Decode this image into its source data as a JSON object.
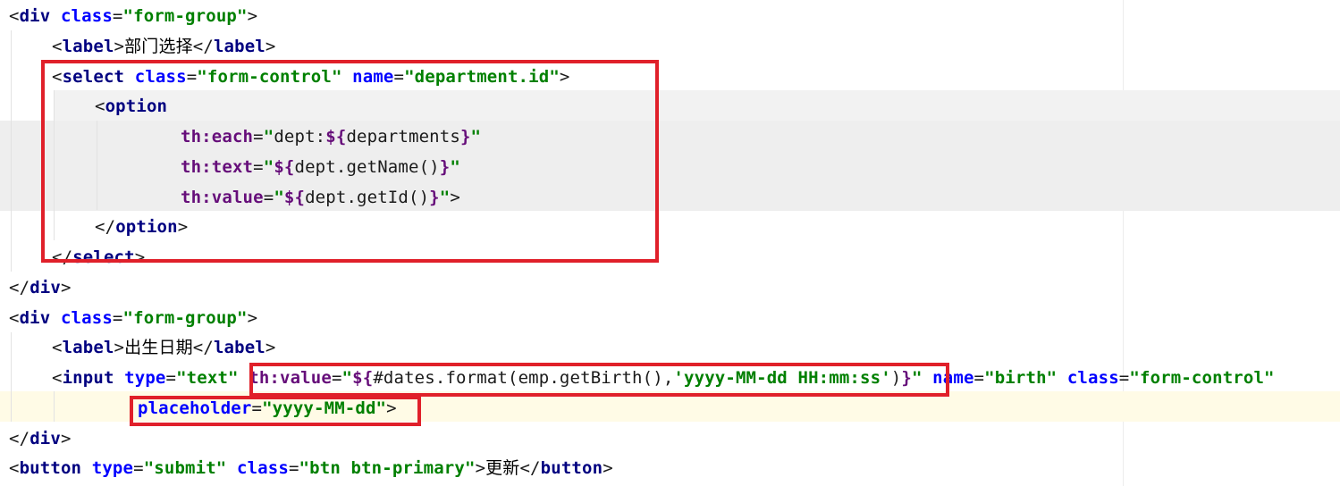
{
  "editor": {
    "lines": [
      {
        "indent": 0,
        "tokens": [
          {
            "t": "punct",
            "v": "<"
          },
          {
            "t": "tag",
            "v": "div"
          },
          {
            "t": "punct",
            "v": " "
          },
          {
            "t": "attr",
            "v": "class"
          },
          {
            "t": "punct",
            "v": "="
          },
          {
            "t": "val",
            "v": "\"form-group\""
          },
          {
            "t": "punct",
            "v": ">"
          }
        ]
      },
      {
        "indent": 1,
        "tokens": [
          {
            "t": "punct",
            "v": "<"
          },
          {
            "t": "tag",
            "v": "label"
          },
          {
            "t": "punct",
            "v": ">"
          },
          {
            "t": "text",
            "v": "部门选择"
          },
          {
            "t": "punct",
            "v": "</"
          },
          {
            "t": "tag",
            "v": "label"
          },
          {
            "t": "punct",
            "v": ">"
          }
        ]
      },
      {
        "indent": 1,
        "tokens": [
          {
            "t": "punct",
            "v": "<"
          },
          {
            "t": "tag",
            "v": "select"
          },
          {
            "t": "punct",
            "v": " "
          },
          {
            "t": "attr",
            "v": "class"
          },
          {
            "t": "punct",
            "v": "="
          },
          {
            "t": "val",
            "v": "\"form-control\""
          },
          {
            "t": "punct",
            "v": " "
          },
          {
            "t": "attr",
            "v": "name"
          },
          {
            "t": "punct",
            "v": "="
          },
          {
            "t": "val",
            "v": "\"department.id\""
          },
          {
            "t": "punct",
            "v": ">"
          }
        ]
      },
      {
        "indent": 2,
        "tokens": [
          {
            "t": "punct",
            "v": "<"
          },
          {
            "t": "tag",
            "v": "option"
          }
        ]
      },
      {
        "indent": 4,
        "tokens": [
          {
            "t": "th",
            "v": "th:each"
          },
          {
            "t": "punct",
            "v": "="
          },
          {
            "t": "val",
            "v": "\""
          },
          {
            "t": "expr",
            "v": "dept:"
          },
          {
            "t": "th",
            "v": "${"
          },
          {
            "t": "expr",
            "v": "departments"
          },
          {
            "t": "th",
            "v": "}"
          },
          {
            "t": "val",
            "v": "\""
          }
        ]
      },
      {
        "indent": 4,
        "tokens": [
          {
            "t": "th",
            "v": "th:text"
          },
          {
            "t": "punct",
            "v": "="
          },
          {
            "t": "val",
            "v": "\""
          },
          {
            "t": "th",
            "v": "${"
          },
          {
            "t": "expr",
            "v": "dept.getName()"
          },
          {
            "t": "th",
            "v": "}"
          },
          {
            "t": "val",
            "v": "\""
          }
        ]
      },
      {
        "indent": 4,
        "tokens": [
          {
            "t": "th",
            "v": "th:value"
          },
          {
            "t": "punct",
            "v": "="
          },
          {
            "t": "val",
            "v": "\""
          },
          {
            "t": "th",
            "v": "${"
          },
          {
            "t": "expr",
            "v": "dept.getId()"
          },
          {
            "t": "th",
            "v": "}"
          },
          {
            "t": "val",
            "v": "\""
          },
          {
            "t": "punct",
            "v": ">"
          }
        ]
      },
      {
        "indent": 2,
        "tokens": [
          {
            "t": "punct",
            "v": "</"
          },
          {
            "t": "tag",
            "v": "option"
          },
          {
            "t": "punct",
            "v": ">"
          }
        ]
      },
      {
        "indent": 1,
        "tokens": [
          {
            "t": "punct",
            "v": "</"
          },
          {
            "t": "tag",
            "v": "select"
          },
          {
            "t": "punct",
            "v": ">"
          }
        ]
      },
      {
        "indent": 0,
        "tokens": [
          {
            "t": "punct",
            "v": "</"
          },
          {
            "t": "tag",
            "v": "div"
          },
          {
            "t": "punct",
            "v": ">"
          }
        ]
      },
      {
        "indent": 0,
        "tokens": [
          {
            "t": "punct",
            "v": "<"
          },
          {
            "t": "tag",
            "v": "div"
          },
          {
            "t": "punct",
            "v": " "
          },
          {
            "t": "attr",
            "v": "class"
          },
          {
            "t": "punct",
            "v": "="
          },
          {
            "t": "val",
            "v": "\"form-group\""
          },
          {
            "t": "punct",
            "v": ">"
          }
        ]
      },
      {
        "indent": 1,
        "tokens": [
          {
            "t": "punct",
            "v": "<"
          },
          {
            "t": "tag",
            "v": "label"
          },
          {
            "t": "punct",
            "v": ">"
          },
          {
            "t": "text",
            "v": "出生日期"
          },
          {
            "t": "punct",
            "v": "</"
          },
          {
            "t": "tag",
            "v": "label"
          },
          {
            "t": "punct",
            "v": ">"
          }
        ]
      },
      {
        "indent": 1,
        "tokens": [
          {
            "t": "punct",
            "v": "<"
          },
          {
            "t": "tag",
            "v": "input"
          },
          {
            "t": "punct",
            "v": " "
          },
          {
            "t": "attr",
            "v": "type"
          },
          {
            "t": "punct",
            "v": "="
          },
          {
            "t": "val",
            "v": "\"text\""
          },
          {
            "t": "punct",
            "v": " "
          },
          {
            "t": "th",
            "v": "th:value"
          },
          {
            "t": "punct",
            "v": "="
          },
          {
            "t": "val",
            "v": "\""
          },
          {
            "t": "th",
            "v": "${"
          },
          {
            "t": "expr",
            "v": "#dates.format(emp.getBirth(),"
          },
          {
            "t": "val",
            "v": "'yyyy-MM-dd HH:mm:ss'"
          },
          {
            "t": "expr",
            "v": ")"
          },
          {
            "t": "th",
            "v": "}"
          },
          {
            "t": "val",
            "v": "\""
          },
          {
            "t": "punct",
            "v": " "
          },
          {
            "t": "attr",
            "v": "name"
          },
          {
            "t": "punct",
            "v": "="
          },
          {
            "t": "val",
            "v": "\"birth\""
          },
          {
            "t": "punct",
            "v": " "
          },
          {
            "t": "attr",
            "v": "class"
          },
          {
            "t": "punct",
            "v": "="
          },
          {
            "t": "val",
            "v": "\"form-control\""
          }
        ]
      },
      {
        "indent": 3,
        "tokens": [
          {
            "t": "attr",
            "v": "placeholder"
          },
          {
            "t": "punct",
            "v": "="
          },
          {
            "t": "val",
            "v": "\"yyyy-MM-dd\""
          },
          {
            "t": "punct",
            "v": ">"
          }
        ]
      },
      {
        "indent": 0,
        "tokens": [
          {
            "t": "punct",
            "v": "</"
          },
          {
            "t": "tag",
            "v": "div"
          },
          {
            "t": "punct",
            "v": ">"
          }
        ]
      },
      {
        "indent": 0,
        "tokens": [
          {
            "t": "punct",
            "v": "<"
          },
          {
            "t": "tag",
            "v": "button"
          },
          {
            "t": "punct",
            "v": " "
          },
          {
            "t": "attr",
            "v": "type"
          },
          {
            "t": "punct",
            "v": "="
          },
          {
            "t": "val",
            "v": "\"submit\""
          },
          {
            "t": "punct",
            "v": " "
          },
          {
            "t": "attr",
            "v": "class"
          },
          {
            "t": "punct",
            "v": "="
          },
          {
            "t": "val",
            "v": "\"btn btn-primary\""
          },
          {
            "t": "punct",
            "v": ">"
          },
          {
            "t": "text",
            "v": "更新"
          },
          {
            "t": "punct",
            "v": "</"
          },
          {
            "t": "tag",
            "v": "button"
          },
          {
            "t": "punct",
            "v": ">"
          }
        ]
      }
    ],
    "colors": {
      "tag": "#000080",
      "attribute": "#0000ff",
      "value": "#008000",
      "thymeleaf": "#660e7a",
      "highlight_box": "#e0202a",
      "band_gray": "#f2f2f2",
      "caret_line": "#fffbe6"
    }
  }
}
